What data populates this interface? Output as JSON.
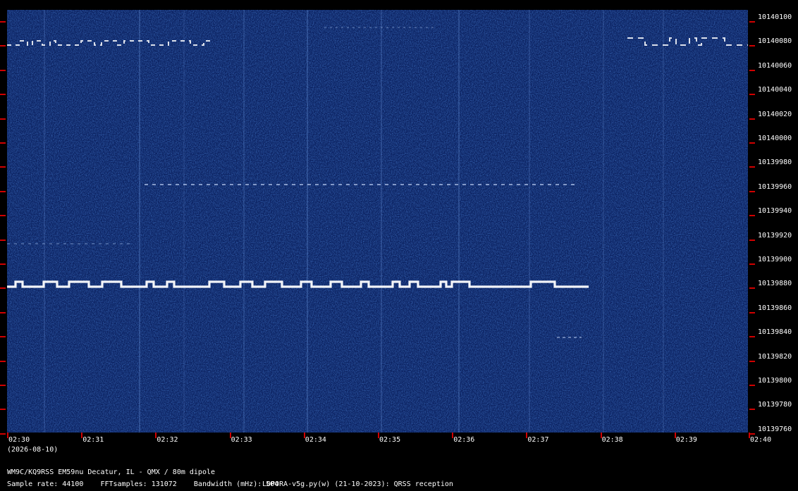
{
  "frequency_labels": [
    "10140100",
    "10140080",
    "10140060",
    "10140040",
    "10140020",
    "10140000",
    "10139980",
    "10139960",
    "10139940",
    "10139920",
    "10139900",
    "10139880",
    "10139860",
    "10139840",
    "10139820",
    "10139800",
    "10139780",
    "10139760"
  ],
  "time_labels": [
    "02:30",
    "02:31",
    "02:32",
    "02:33",
    "02:34",
    "02:35",
    "02:36",
    "02:37",
    "02:38",
    "02:39",
    "02:40"
  ],
  "date": "(2026-08-10)",
  "station": "WM9C/KQ9RSS EM59nu Decatur, IL - QMX / 80m dipole",
  "parameters": "Sample rate: 44100    FFTsamples: 131072    Bandwidth (mHz): 504",
  "software": "LOPORA-v5g.py(w) (21-10-2023): QRSS reception",
  "colors": {
    "background": "#000000",
    "waterfall": "#0b2160",
    "tick": "#d00000",
    "signal": "#ffffff"
  }
}
